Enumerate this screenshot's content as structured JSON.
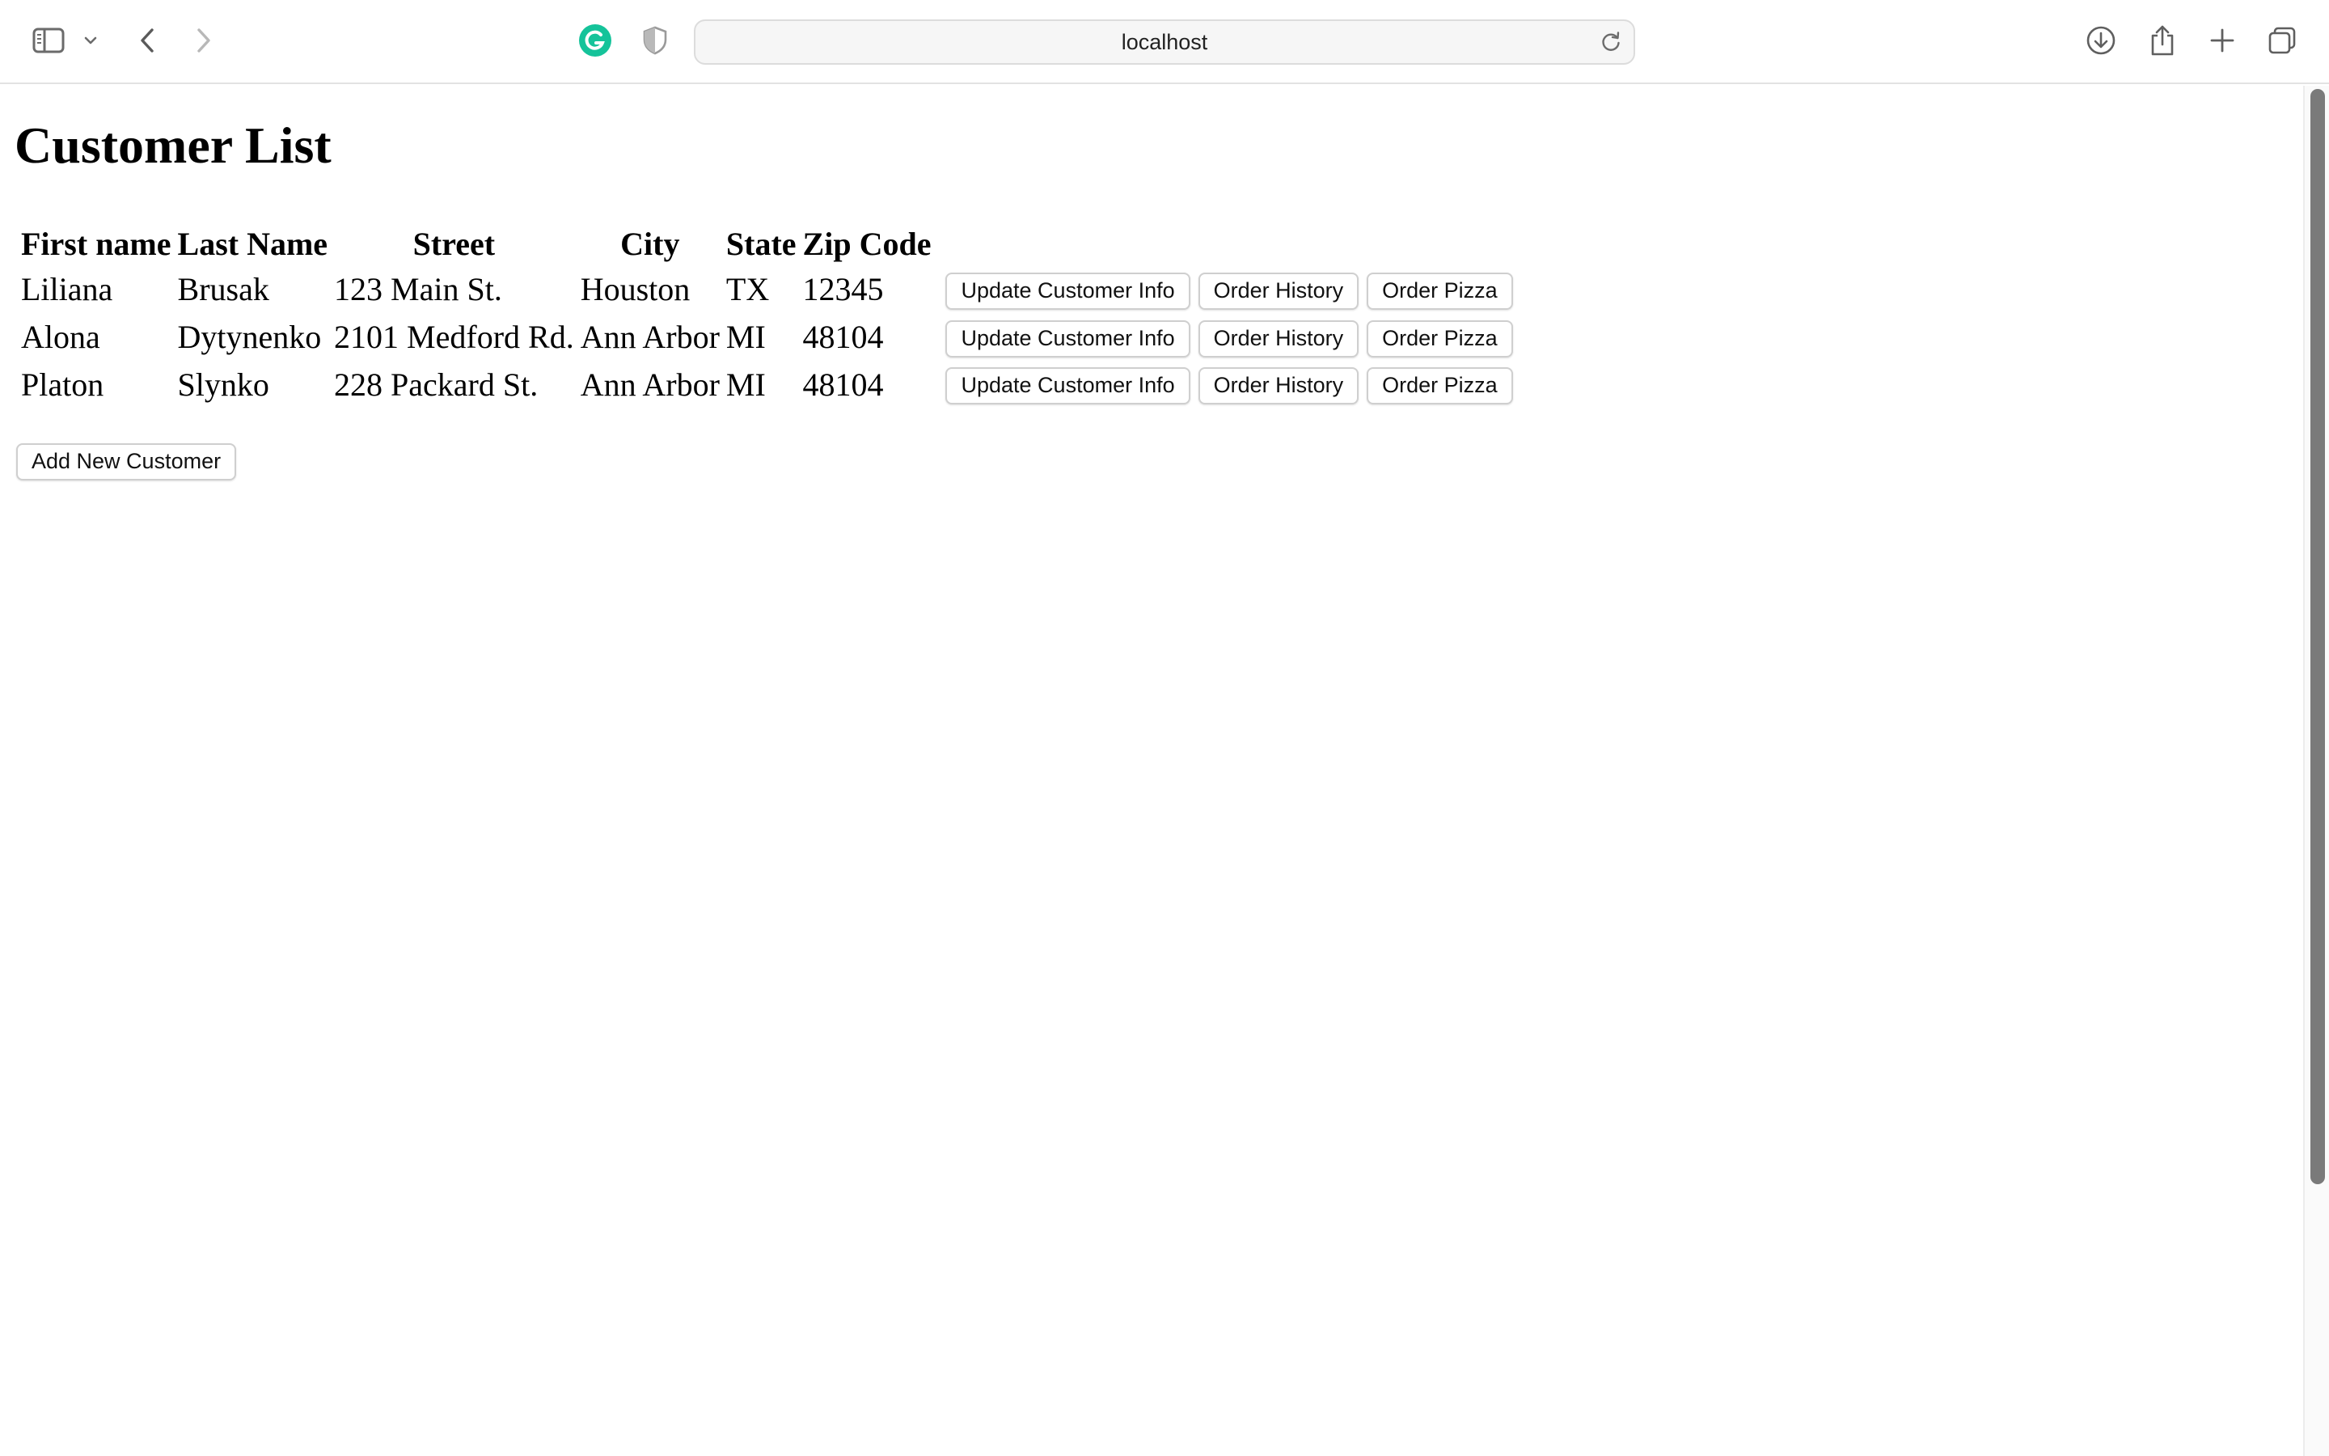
{
  "browser": {
    "address": "localhost",
    "icons": {
      "sidebar": "sidebar-icon",
      "tab_group_menu": "chevron-down-icon",
      "back": "back-arrow-icon",
      "forward": "forward-arrow-icon",
      "grammarly": "grammarly-extension-icon",
      "privacy": "shield-icon",
      "reload": "reload-icon",
      "downloads": "download-icon",
      "share": "share-icon",
      "new_tab": "plus-icon",
      "tab_overview": "tabs-overview-icon"
    },
    "grammarly_color": "#15c39a"
  },
  "page": {
    "title": "Customer List",
    "table": {
      "headers": [
        "First name",
        "Last Name",
        "Street",
        "City",
        "State",
        "Zip Code"
      ],
      "rows": [
        {
          "first": "Liliana",
          "last": "Brusak",
          "street": "123 Main St.",
          "city": "Houston",
          "state": "TX",
          "zip": "12345"
        },
        {
          "first": "Alona",
          "last": "Dytynenko",
          "street": "2101 Medford Rd.",
          "city": "Ann Arbor",
          "state": "MI",
          "zip": "48104"
        },
        {
          "first": "Platon",
          "last": "Slynko",
          "street": "228 Packard St.",
          "city": "Ann Arbor",
          "state": "MI",
          "zip": "48104"
        }
      ],
      "actions": {
        "update": "Update Customer Info",
        "history": "Order History",
        "order": "Order Pizza"
      }
    },
    "add_button": "Add New Customer"
  }
}
